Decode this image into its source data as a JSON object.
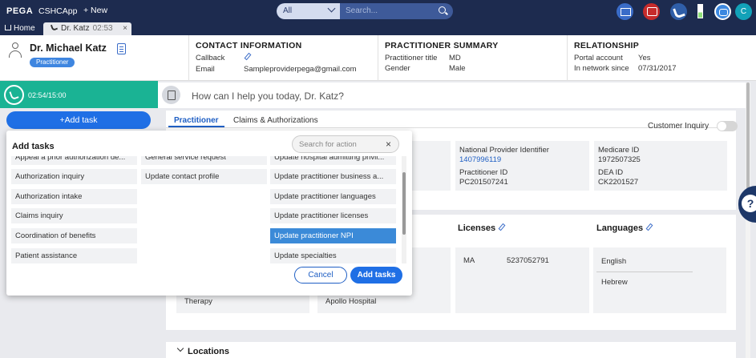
{
  "topbar": {
    "brand": "PEGA",
    "app_name": "CSHCApp",
    "new_label": "+ New",
    "search_scope": "All",
    "search_placeholder": "Search...",
    "user_initial": "C"
  },
  "tabs": {
    "home_label": "Home",
    "active_label": "Dr. Katz",
    "active_time": "02:53",
    "close_glyph": "×"
  },
  "header": {
    "name": "Dr. Michael Katz",
    "badge": "Practitioner",
    "contact": {
      "title": "CONTACT INFORMATION",
      "callback_label": "Callback",
      "email_label": "Email",
      "email_value": "Sampleproviderpega@gmail.com"
    },
    "summary": {
      "title": "PRACTITIONER SUMMARY",
      "title_label": "Practitioner title",
      "title_value": "MD",
      "gender_label": "Gender",
      "gender_value": "Male"
    },
    "relationship": {
      "title": "RELATIONSHIP",
      "portal_label": "Portal account",
      "portal_value": "Yes",
      "network_label": "In network since",
      "network_value": "07/31/2017"
    }
  },
  "left": {
    "call_time": "02:54/15:00",
    "add_task_label": "+Add task"
  },
  "main": {
    "ask_prompt": "How can I help you today, Dr. Katz?",
    "tabs": [
      "Practitioner",
      "Claims & Authorizations"
    ],
    "customer_inquiry_label": "Customer Inquiry",
    "npi_label": "National Provider Identifier",
    "npi_value": "1407996119",
    "practitioner_id_label": "Practitioner ID",
    "practitioner_id_value": "PC201507241",
    "medicare_label": "Medicare ID",
    "medicare_value": "1972507325",
    "dea_label": "DEA ID",
    "dea_value": "CK2201527",
    "licenses_title": "Licenses",
    "license_state": "MA",
    "license_number": "5237052791",
    "languages_title": "Languages",
    "languages": [
      "English",
      "Hebrew"
    ],
    "therapy_text": "Therapy",
    "hospital_text": "Apollo Hospital",
    "locations_title": "Locations",
    "help_glyph": "?"
  },
  "popup": {
    "title": "Add tasks",
    "search_placeholder": "Search for action",
    "clear_glyph": "×",
    "col1": [
      "Appeal a prior authorization de...",
      "Authorization inquiry",
      "Authorization intake",
      "Claims inquiry",
      "Coordination of benefits",
      "Patient assistance"
    ],
    "col2": [
      "General service request",
      "Update contact profile"
    ],
    "col3": [
      "Update hospital admitting privil...",
      "Update practitioner business a...",
      "Update practitioner languages",
      "Update practitioner licenses",
      "Update practitioner NPI",
      "Update specialties"
    ],
    "selected": "Update practitioner NPI",
    "cancel_label": "Cancel",
    "add_label": "Add tasks"
  }
}
